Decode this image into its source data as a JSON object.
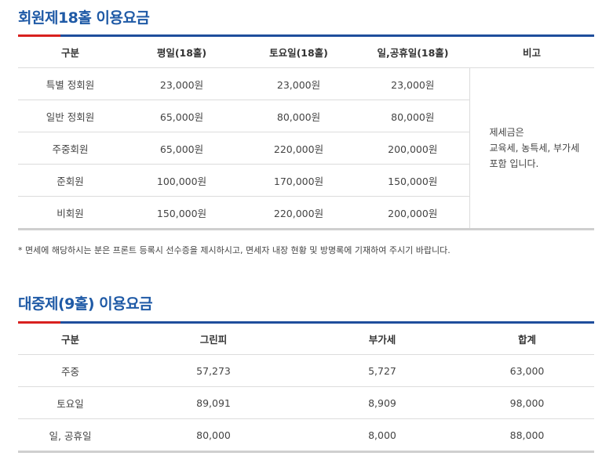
{
  "section1": {
    "title": "회원제18홀 이용요금",
    "headers": [
      "구분",
      "평일(18홀)",
      "토요일(18홀)",
      "일,공휴일(18홀)",
      "비고"
    ],
    "rows": [
      {
        "category": "특별 정회원",
        "weekday": "23,000원",
        "saturday": "23,000원",
        "holiday": "23,000원"
      },
      {
        "category": "일반 정회원",
        "weekday": "65,000원",
        "saturday": "80,000원",
        "holiday": "80,000원"
      },
      {
        "category": "주중회원",
        "weekday": "65,000원",
        "saturday": "220,000원",
        "holiday": "200,000원"
      },
      {
        "category": "준회원",
        "weekday": "100,000원",
        "saturday": "170,000원",
        "holiday": "150,000원"
      },
      {
        "category": "비회원",
        "weekday": "150,000원",
        "saturday": "220,000원",
        "holiday": "200,000원"
      }
    ],
    "note_lines": [
      "제세금은",
      "교육세, 농특세, 부가세",
      "포함 입니다."
    ],
    "footnote": "* 면세에 해당하시는 분은 프론트 등록시 선수증을 제시하시고, 면세자 내장 현황 및 방명록에 기재하여 주시기 바랍니다."
  },
  "section2": {
    "title": "대중제(9홀) 이용요금",
    "headers": [
      "구분",
      "그린피",
      "부가세",
      "합계"
    ],
    "rows": [
      {
        "category": "주중",
        "greenfee": "57,273",
        "vat": "5,727",
        "total": "63,000"
      },
      {
        "category": "토요일",
        "greenfee": "89,091",
        "vat": "8,909",
        "total": "98,000"
      },
      {
        "category": "일, 공휴일",
        "greenfee": "80,000",
        "vat": "8,000",
        "total": "88,000"
      }
    ]
  },
  "colors": {
    "title": "#1f5aa6",
    "accent_red": "#d8201f",
    "accent_blue": "#1f4e9c"
  }
}
